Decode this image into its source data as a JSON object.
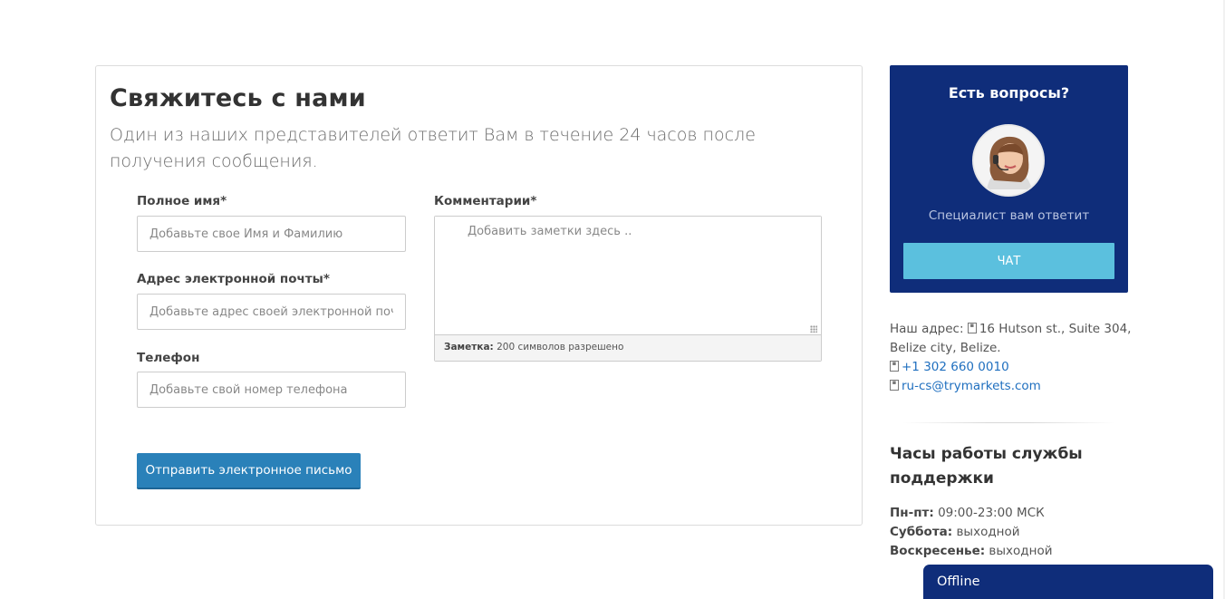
{
  "contact": {
    "title": "Свяжитесь с нами",
    "subtitle": "Один из наших представителей ответит Вам в течение 24 часов после получения сообщения.",
    "full_name": {
      "label": "Полное имя*",
      "placeholder": "Добавьте свое Имя и Фамилию",
      "value": ""
    },
    "email": {
      "label": "Адрес электронной почты*",
      "placeholder": "Добавьте адрес своей электронной почты",
      "value": ""
    },
    "phone": {
      "label": "Телефон",
      "placeholder": "Добавьте свой номер телефона",
      "value": ""
    },
    "comments": {
      "label": "Комментарии*",
      "placeholder": "Добавить заметки здесь ..",
      "value": ""
    },
    "note_bold": "Заметка:",
    "note_text": " 200 символов разрешено",
    "send_label": "Отправить электронное письмо"
  },
  "chat": {
    "title": "Есть вопросы?",
    "caption": "Специалист вам ответит",
    "button_label": "ЧАТ",
    "avatar_icon": "support-agent-avatar"
  },
  "address": {
    "prefix": "Наш адрес: ",
    "line1": "16 Hutson st., Suite 304,",
    "line2": "Belize city, Belize.",
    "phone": "+1 302 660 0010",
    "email": "ru-cs@trymarkets.com",
    "glyph_icon": "missing-glyph-icon"
  },
  "hours": {
    "title": "Часы работы службы поддержки",
    "weekdays_label": "Пн-пт:",
    "weekdays_value": " 09:00-23:00 МСК",
    "saturday_label": "Суббота:",
    "saturday_value": " выходной",
    "sunday_label": "Воскресенье:",
    "sunday_value": " выходной"
  },
  "offline_tab": {
    "label": "Offline"
  },
  "colors": {
    "panel": "#0f2d7a",
    "send_button": "#2a81b9",
    "chat_button": "#5bc0de",
    "link": "#1f6fbf"
  }
}
